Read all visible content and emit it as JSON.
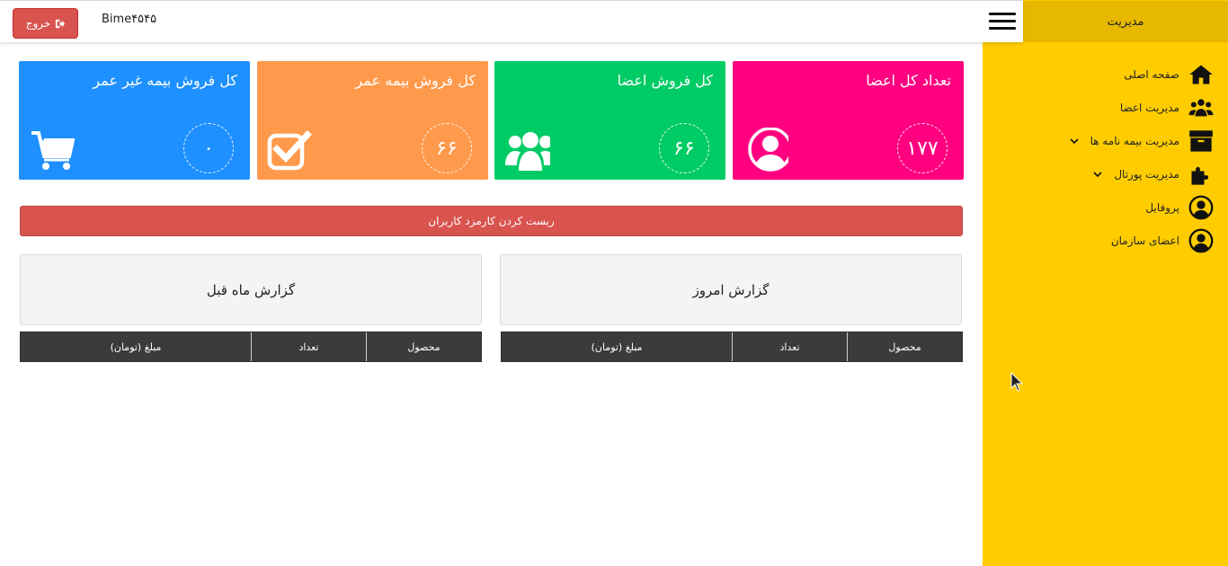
{
  "topbar": {
    "brand": "Bime۴۵۴۵",
    "logout_label": "خروج"
  },
  "sidebar": {
    "header": "مدیریت",
    "items": [
      {
        "label": "صفحه اصلی",
        "icon": "home-icon"
      },
      {
        "label": "مدیریت اعضا",
        "icon": "users-icon"
      },
      {
        "label": "مدیریت بیمه نامه ها",
        "icon": "archive-icon",
        "has_submenu": true
      },
      {
        "label": "مدیریت پورتال",
        "icon": "puzzle-icon",
        "has_submenu": true
      },
      {
        "label": "پروفایل",
        "icon": "user-circle-icon"
      },
      {
        "label": "اعضای سازمان",
        "icon": "user-circle-icon"
      }
    ]
  },
  "cards": [
    {
      "title": "تعداد کل اعضا",
      "value": "۱۷۷",
      "color": "#ff0080",
      "icon": "user-circle-icon"
    },
    {
      "title": "کل فروش اعضا",
      "value": "۶۶",
      "color": "#00cc66",
      "icon": "users-icon"
    },
    {
      "title": "کل فروش بیمه عمر",
      "value": "۶۶",
      "color": "#ff9a4d",
      "icon": "check-square-icon"
    },
    {
      "title": "کل فروش بیمه غیر عمر",
      "value": "۰",
      "color": "#1e90ff",
      "icon": "cart-icon"
    }
  ],
  "reset_button": "ریست کردن کارمزد کاربران",
  "reports": {
    "today": {
      "title": "گزارش امروز"
    },
    "last_month": {
      "title": "گزارش ماه قبل"
    },
    "columns": [
      "محصول",
      "تعداد",
      "مبلغ (تومان)"
    ]
  },
  "colors": {
    "sidebar": "#ffcc00",
    "sidebar_header": "#e6b800",
    "danger": "#d9534f",
    "table_header": "#3b3b3b"
  }
}
